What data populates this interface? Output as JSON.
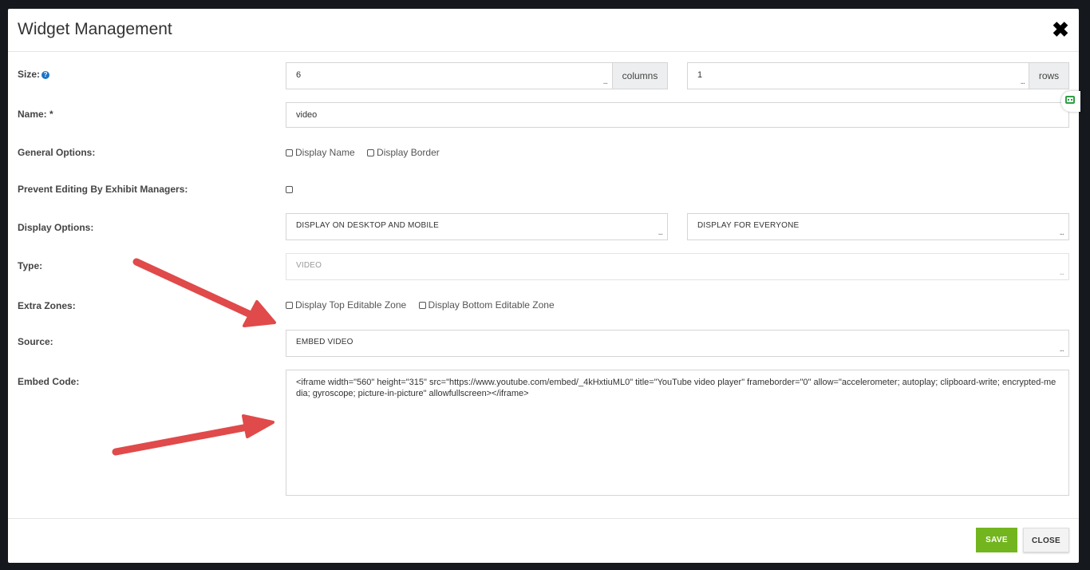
{
  "modal": {
    "title": "Widget Management"
  },
  "fields": {
    "size_label": "Size:",
    "size_columns_value": "6",
    "size_columns_addon": "columns",
    "size_rows_value": "1",
    "size_rows_addon": "rows",
    "name_label": "Name: *",
    "name_value": "video",
    "general_options_label": "General Options:",
    "display_name_label": "Display Name",
    "display_border_label": "Display Border",
    "prevent_editing_label": "Prevent Editing By Exhibit Managers:",
    "display_options_label": "Display Options:",
    "display_device_value": "DISPLAY ON DESKTOP AND MOBILE",
    "display_audience_value": "DISPLAY FOR EVERYONE",
    "type_label": "Type:",
    "type_value": "VIDEO",
    "extra_zones_label": "Extra Zones:",
    "top_zone_label": "Display Top Editable Zone",
    "bottom_zone_label": "Display Bottom Editable Zone",
    "source_label": "Source:",
    "source_value": "EMBED VIDEO",
    "embed_code_label": "Embed Code:",
    "embed_code_value": "<iframe width=\"560\" height=\"315\" src=\"https://www.youtube.com/embed/_4kHxtiuML0\" title=\"YouTube video player\" frameborder=\"0\" allow=\"accelerometer; autoplay; clipboard-write; encrypted-media; gyroscope; picture-in-picture\" allowfullscreen></iframe>",
    "ellipsis": "..."
  },
  "footer": {
    "save_label": "SAVE",
    "close_label": "CLOSE"
  },
  "colors": {
    "save_button": "#72b51e",
    "annotation_arrow": "#e04a4a",
    "help_icon": "#1a73c9"
  }
}
